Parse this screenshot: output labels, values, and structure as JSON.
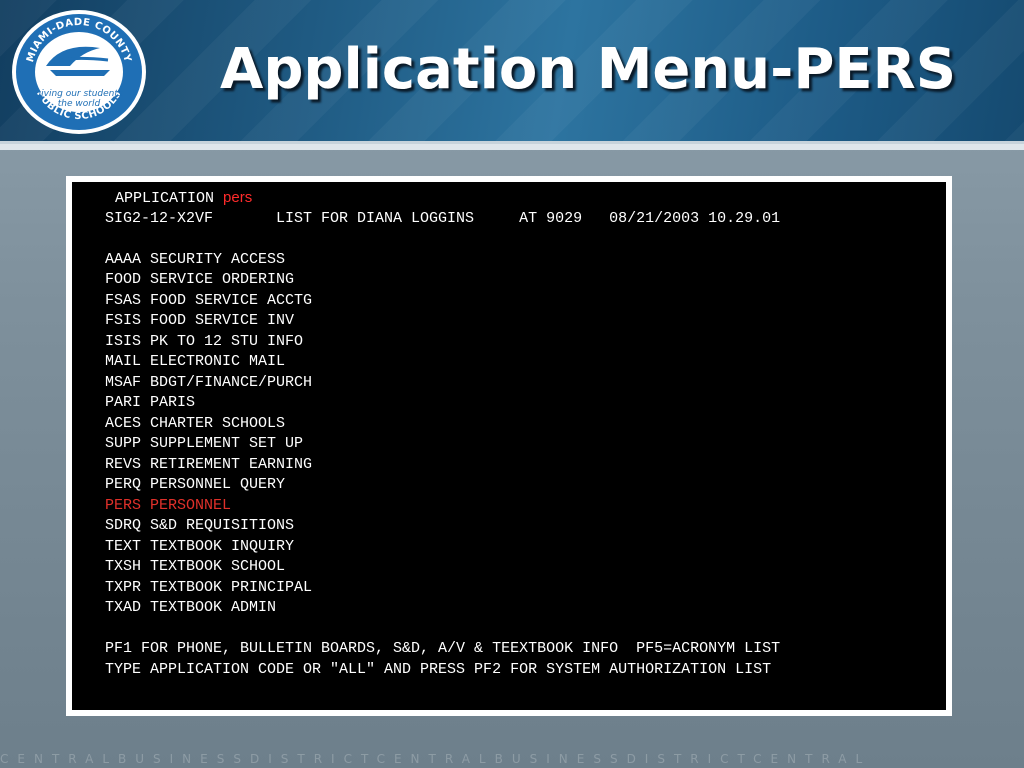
{
  "header": {
    "title": "Application Menu-PERS",
    "seal": {
      "top_text": "MIAMI-DADE COUNTY",
      "middle_text_1": "giving our students",
      "middle_text_2": "the world",
      "bottom_text": "PUBLIC SCHOOLS"
    }
  },
  "terminal": {
    "line1_prefix": "APPLICATION ",
    "line1_code": "pers",
    "line2": "SIG2-12-X2VF       LIST FOR DIANA LOGGINS     AT 9029   08/21/2003 10.29.01",
    "menu": [
      {
        "code": "AAAA",
        "label": "SECURITY ACCESS"
      },
      {
        "code": "FOOD",
        "label": "SERVICE ORDERING"
      },
      {
        "code": "FSAS",
        "label": "FOOD SERVICE ACCTG"
      },
      {
        "code": "FSIS",
        "label": "FOOD SERVICE INV"
      },
      {
        "code": "ISIS",
        "label": "PK TO 12 STU INFO"
      },
      {
        "code": "MAIL",
        "label": "ELECTRONIC MAIL"
      },
      {
        "code": "MSAF",
        "label": "BDGT/FINANCE/PURCH"
      },
      {
        "code": "PARI",
        "label": "PARIS"
      },
      {
        "code": "ACES",
        "label": "CHARTER SCHOOLS"
      },
      {
        "code": "SUPP",
        "label": "SUPPLEMENT SET UP"
      },
      {
        "code": "REVS",
        "label": "RETIREMENT EARNING"
      },
      {
        "code": "PERQ",
        "label": "PERSONNEL QUERY"
      },
      {
        "code": "PERS",
        "label": "PERSONNEL",
        "highlight_color": "#e0302a"
      },
      {
        "code": "SDRQ",
        "label": "S&D REQUISITIONS"
      },
      {
        "code": "TEXT",
        "label": "TEXTBOOK INQUIRY"
      },
      {
        "code": "TXSH",
        "label": "TEXTBOOK SCHOOL"
      },
      {
        "code": "TXPR",
        "label": "TEXTBOOK PRINCIPAL"
      },
      {
        "code": "TXAD",
        "label": "TEXTBOOK ADMIN"
      }
    ],
    "footer1": "PF1 FOR PHONE, BULLETIN BOARDS, S&D, A/V & TEEXTBOOK INFO  PF5=ACRONYM LIST",
    "footer2": "TYPE APPLICATION CODE OR \"ALL\" AND PRESS PF2 FOR SYSTEM AUTHORIZATION LIST"
  },
  "background_text": "CENTRALBUSINESSDISTRICTCENTRALBUSINESSDISTRICTCENTRAL",
  "colors": {
    "header_blue": "#1f5a82",
    "terminal_bg": "#000000",
    "terminal_text": "#ffffff",
    "highlight_red": "#e0302a"
  }
}
